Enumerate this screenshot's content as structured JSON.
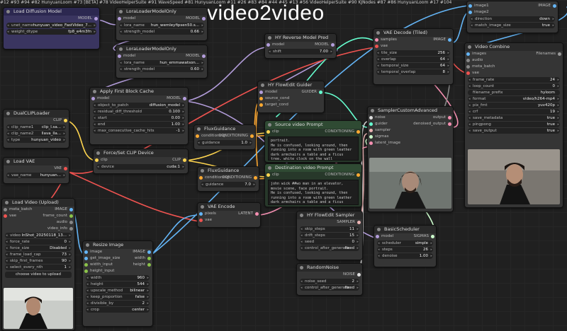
{
  "header": {
    "title": "video2video"
  },
  "colors": {
    "model": "#b39ddb",
    "clip": "#ffd54f",
    "vae": "#ef5350",
    "image": "#64b5f6",
    "latent": "#f48fb1",
    "conditioning": "#ffa931",
    "guider": "#66ffd0",
    "noise": "#dddddd",
    "sampler": "#ecb4b4",
    "sigmas": "#cdffcd"
  },
  "nodes": {
    "load_diffusion": {
      "title": "Load Diffusion Model",
      "id": "#12",
      "out": "MODEL",
      "w": [
        {
          "l": "unet_name",
          "v": "hunyuan_video_FastVideo_7..."
        },
        {
          "l": "weight_dtype",
          "v": "fp8_e4m3fn"
        }
      ]
    },
    "lora1": {
      "title": "LoraLoaderModelOnly",
      "id": "#93",
      "in": "model",
      "out": "MODEL",
      "w": [
        {
          "l": "lora_name",
          "v": "hun_wemleyfipsen50.s..."
        },
        {
          "l": "strength_model",
          "v": "0.66"
        }
      ]
    },
    "lora2": {
      "title": "LoraLoaderModelOnly",
      "id": "#94",
      "in": "model",
      "out": "MODEL",
      "w": [
        {
          "l": "lora_name",
          "v": "hun_emmawatson..."
        },
        {
          "l": "strength_model",
          "v": "0.60"
        }
      ]
    },
    "reverse": {
      "title": "HY Reverse Model Pred",
      "id": "#82 HunyuanLoom",
      "in": "model",
      "out": "MODEL",
      "w": [
        {
          "l": "shift",
          "v": "7.00"
        }
      ]
    },
    "vae_decode": {
      "title": "VAE Decode (Tiled)",
      "id": "#73 [BETA]",
      "in1": "samples",
      "in2": "vae",
      "out": "IMAGE",
      "w": [
        {
          "l": "tile_size",
          "v": "256"
        },
        {
          "l": "overlap",
          "v": "64"
        },
        {
          "l": "temporal_size",
          "v": "64"
        },
        {
          "l": "temporal_overlap",
          "v": "8"
        }
      ]
    },
    "top_right": {
      "in1": "image1",
      "in2": "image2",
      "out": "IMAGE",
      "w": [
        {
          "l": "direction",
          "v": "down"
        },
        {
          "l": "match_image_size",
          "v": "true"
        }
      ]
    },
    "video_combine": {
      "title": "Video Combine",
      "id": "#78 VideoHelperSuite",
      "inputs": [
        "images",
        "audio",
        "meta_batch",
        "vae"
      ],
      "out": "Filenames",
      "w": [
        {
          "l": "frame_rate",
          "v": "24"
        },
        {
          "l": "loop_count",
          "v": "0"
        },
        {
          "l": "filename_prefix",
          "v": "hyloom"
        },
        {
          "l": "format",
          "v": "video/h264-mp4"
        },
        {
          "l": "pix_fmt",
          "v": "yuv420p"
        },
        {
          "l": "crf",
          "v": "19"
        },
        {
          "l": "save_metadata",
          "v": "true"
        },
        {
          "l": "pingpong",
          "v": "true"
        },
        {
          "l": "save_output",
          "v": "true"
        }
      ]
    },
    "first_block": {
      "title": "Apply First Block Cache",
      "id": "#91 WaveSpeed",
      "in": "model",
      "out": "MODEL",
      "w": [
        {
          "l": "object_to_patch",
          "v": "diffusion_model"
        },
        {
          "l": "residual_diff_threshold",
          "v": "0.100"
        },
        {
          "l": "start",
          "v": "0.00"
        },
        {
          "l": "end",
          "v": "1.00"
        },
        {
          "l": "max_consecutive_cache_hits",
          "v": "-1"
        }
      ]
    },
    "flowedit_guider": {
      "title": "HY FlowEdit Guider",
      "id": "#81 HunyuanLoom",
      "inputs": [
        "model",
        "source_cond",
        "target_cond"
      ],
      "out": "GUIDER"
    },
    "dual_clip": {
      "title": "DualCLIPLoader",
      "id": "#11",
      "out": "CLIP",
      "w": [
        {
          "l": "clip_name1",
          "v": "clip_l.sa..."
        },
        {
          "l": "clip_name2",
          "v": "llava_lla..."
        },
        {
          "l": "type",
          "v": "hunyuan_video"
        }
      ]
    },
    "flux_guid1": {
      "title": "FluxGuidance",
      "id": "#26",
      "in": "conditioning",
      "out": "CONDITIONING",
      "w": [
        {
          "l": "guidance",
          "v": "1.0"
        }
      ]
    },
    "force_clip": {
      "title": "Force/Set CLIP Device",
      "id": "#83",
      "in": "clip",
      "out": "CLIP",
      "w": [
        {
          "l": "device",
          "v": "cuda:1"
        }
      ]
    },
    "flux_guid2": {
      "title": "FluxGuidance",
      "id": "#84",
      "in": "conditioning",
      "out": "CONDITIONING",
      "w": [
        {
          "l": "guidance",
          "v": "7.0"
        }
      ]
    },
    "load_vae": {
      "title": "Load VAE",
      "id": "#10",
      "out": "VAE",
      "w": [
        {
          "l": "vae_name",
          "v": "hunyuan..."
        }
      ]
    },
    "source_prompt": {
      "title": "Source video Prompt",
      "id": "#44",
      "in": "clip",
      "out": "CONDITIONING",
      "text": "portrait.\nHe is confused, looking around, then running into a room with green leather dark armchairs a table and a ficus tree, white clock on the wall"
    },
    "dest_prompt": {
      "title": "Destination video Prompt",
      "id": "#45",
      "in": "clip",
      "out": "CONDITIONING",
      "text": "john wick ##wo man in an elevator, movie scene, face portrait.\nHe is confused, looking around, then running into a room with green leather dark armchairs a table and a ficus tree, white clock on the wall"
    },
    "sampler_adv": {
      "title": "SamplerCustomAdvanced",
      "id": "#13",
      "inputs": [
        "noise",
        "guider",
        "sampler",
        "sigmas",
        "latent_image"
      ],
      "out1": "output",
      "out2": "denoised_output"
    },
    "load_video": {
      "title": "Load Video (Upload)",
      "id": "#56 VideoHelperSuite",
      "inputs": [
        "meta_batch",
        "vae"
      ],
      "outputs": [
        "IMAGE",
        "frame_count",
        "audio",
        "video_info"
      ],
      "w": [
        {
          "l": "video",
          "v": "InShot_20250118_13..."
        },
        {
          "l": "force_rate",
          "v": "0"
        },
        {
          "l": "force_size",
          "v": "Disabled"
        },
        {
          "l": "frame_load_cap",
          "v": "73"
        },
        {
          "l": "skip_first_frames",
          "v": "90"
        },
        {
          "l": "select_every_nth",
          "v": "1"
        }
      ],
      "button": "choose video to upload"
    },
    "resize": {
      "title": "Resize Image",
      "id": "#90 KJNodes",
      "inputs": [
        "image",
        "get_image_size",
        "width_input",
        "height_input"
      ],
      "outputs": [
        "IMAGE",
        "width",
        "height"
      ],
      "w": [
        {
          "l": "width",
          "v": "960"
        },
        {
          "l": "height",
          "v": "544"
        },
        {
          "l": "upscale_method",
          "v": "bilinear"
        },
        {
          "l": "keep_proportion",
          "v": "false"
        },
        {
          "l": "divisible_by",
          "v": "2"
        },
        {
          "l": "crop",
          "v": "center"
        }
      ]
    },
    "vae_encode": {
      "title": "VAE Encode",
      "id": "#87",
      "inputs": [
        "pixels",
        "vae"
      ],
      "out": "LATENT"
    },
    "flowedit_sampler": {
      "title": "HY FlowEdit Sampler",
      "id": "#86 HunyuanLoom",
      "out": "SAMPLER",
      "w": [
        {
          "l": "skip_steps",
          "v": "11"
        },
        {
          "l": "drift_steps",
          "v": "15"
        },
        {
          "l": "seed",
          "v": "0"
        },
        {
          "l": "control_after_generate",
          "v": "fixed"
        }
      ]
    },
    "basic_sched": {
      "title": "BasicScheduler",
      "id": "#17",
      "in": "model",
      "out": "SIGMAS",
      "w": [
        {
          "l": "scheduler",
          "v": "simple"
        },
        {
          "l": "steps",
          "v": "26"
        },
        {
          "l": "denoise",
          "v": "1.00"
        }
      ]
    },
    "random_noise": {
      "title": "RandomNoise",
      "id": "#104",
      "out": "NOISE",
      "w": [
        {
          "l": "noise_seed",
          "v": "2"
        },
        {
          "l": "control_after_generate",
          "v": "fixed"
        }
      ]
    }
  }
}
